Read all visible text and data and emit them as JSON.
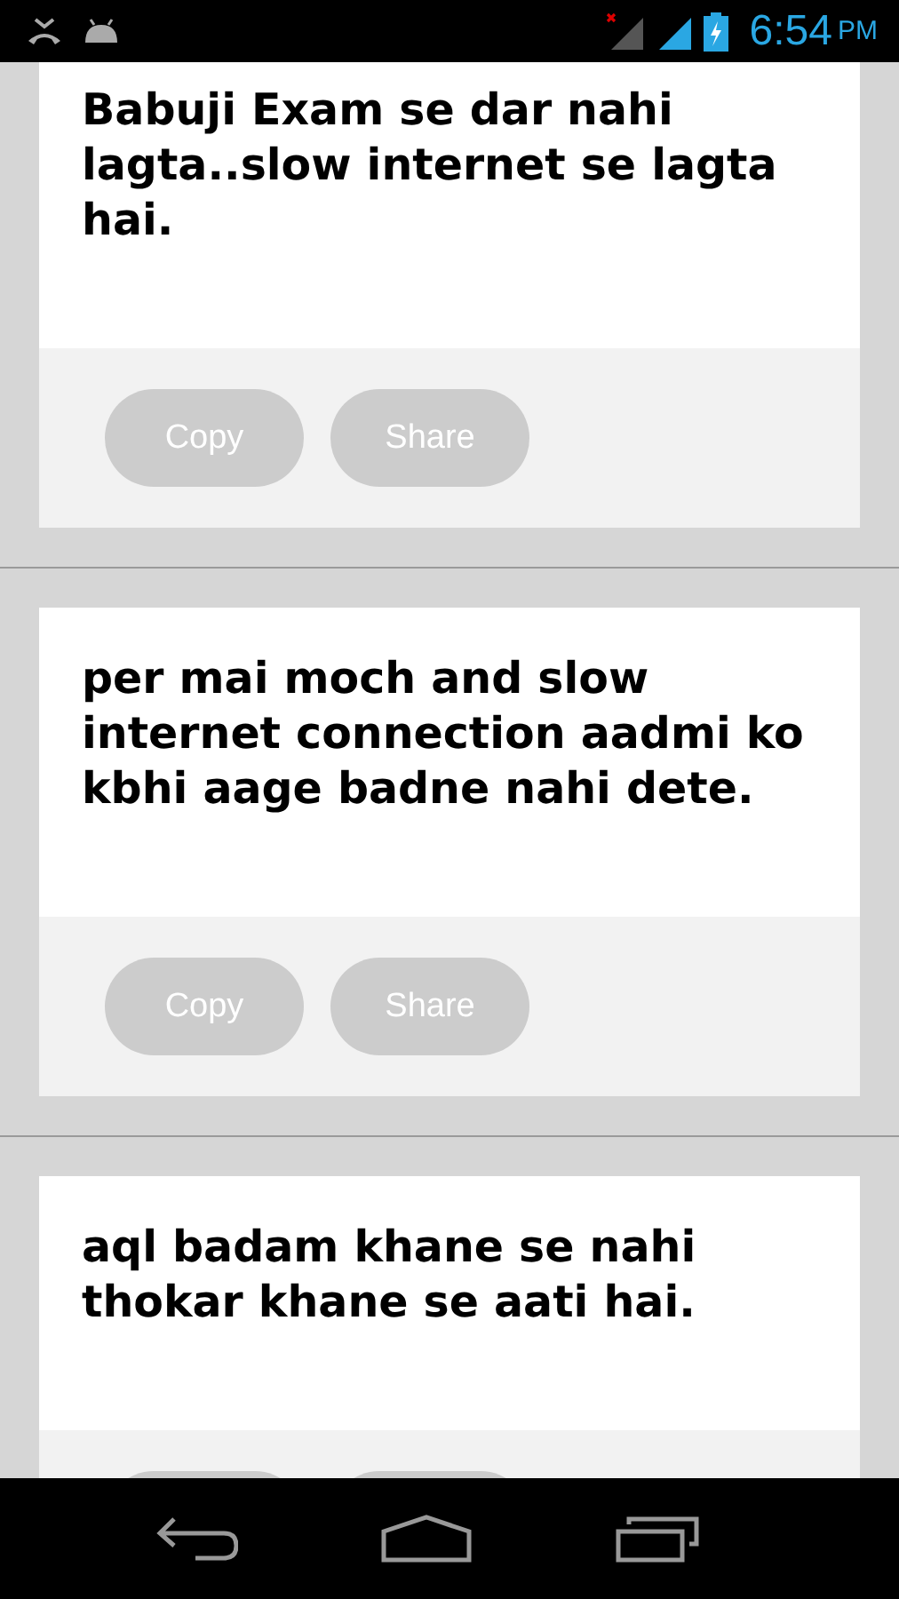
{
  "status_bar": {
    "time": "6:54",
    "meridiem": "PM"
  },
  "cards": [
    {
      "text": "Babuji Exam se dar nahi lagta..slow internet se lagta hai.",
      "buttons": [
        {
          "kind": "labeled",
          "label": "Copy"
        },
        {
          "kind": "labeled",
          "label": "Share"
        }
      ]
    },
    {
      "text": "per mai moch and slow internet connection aadmi ko kbhi aage badne nahi dete.",
      "buttons": [
        {
          "kind": "labeled",
          "label": "Copy"
        },
        {
          "kind": "labeled",
          "label": "Share"
        }
      ]
    },
    {
      "text": "aql badam khane se nahi thokar khane se aati hai.",
      "buttons": [
        {
          "kind": "blank"
        },
        {
          "kind": "blank"
        }
      ]
    }
  ]
}
